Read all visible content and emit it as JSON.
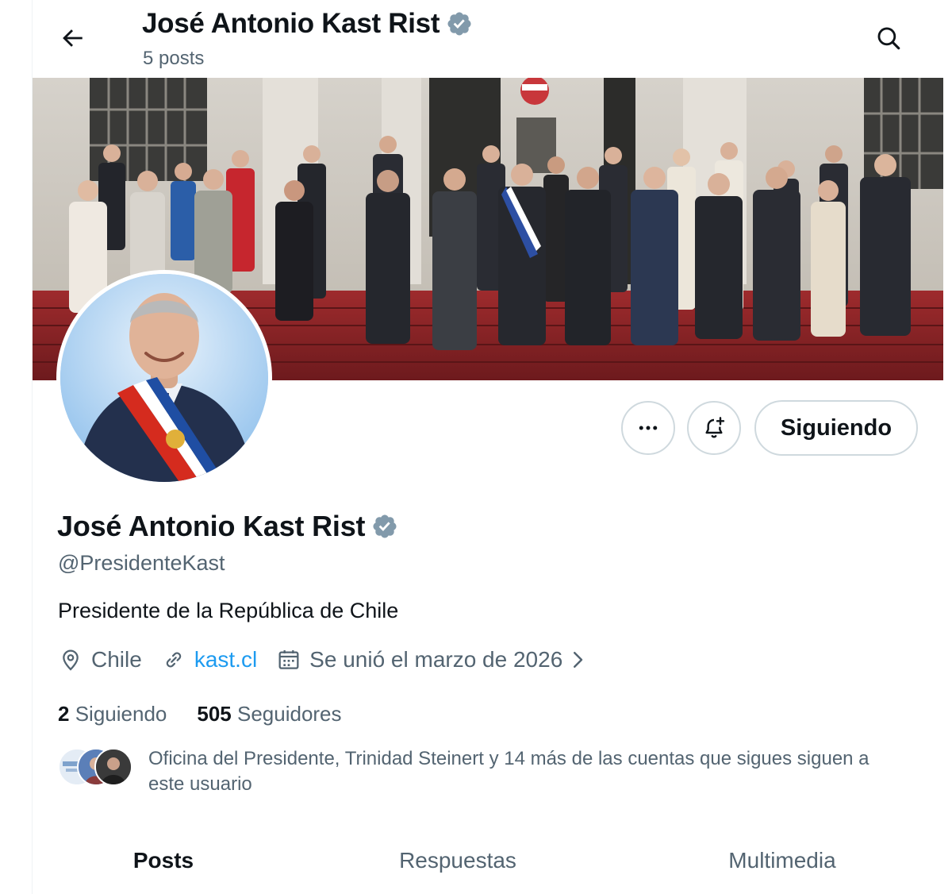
{
  "header": {
    "name": "José Antonio Kast Rist",
    "posts_count": "5 posts"
  },
  "profile": {
    "display_name": "José Antonio Kast Rist",
    "handle": "@PresidenteKast",
    "bio": "Presidente de la República de Chile",
    "location": "Chile",
    "website": "kast.cl",
    "joined": "Se unió el marzo de 2026",
    "following_count": "2",
    "following_label": "Siguiendo",
    "followers_count": "505",
    "followers_label": "Seguidores",
    "followers_you_know": "Oficina del Presidente, Trinidad Steinert y 14 más de las cuentas que sigues siguen a este usuario"
  },
  "actions": {
    "follow_label": "Siguiendo"
  },
  "tabs": [
    {
      "label": "Posts",
      "active": true
    },
    {
      "label": "Respuestas",
      "active": false
    },
    {
      "label": "Multimedia",
      "active": false
    }
  ],
  "colors": {
    "accent": "#1d9bf0",
    "verified_badge": "#829aab",
    "secondary_text": "#536471"
  },
  "icons": [
    "back-arrow-icon",
    "search-icon",
    "verified-badge-icon",
    "more-icon",
    "bell-plus-icon",
    "location-icon",
    "link-icon",
    "calendar-icon",
    "chevron-right-icon"
  ]
}
